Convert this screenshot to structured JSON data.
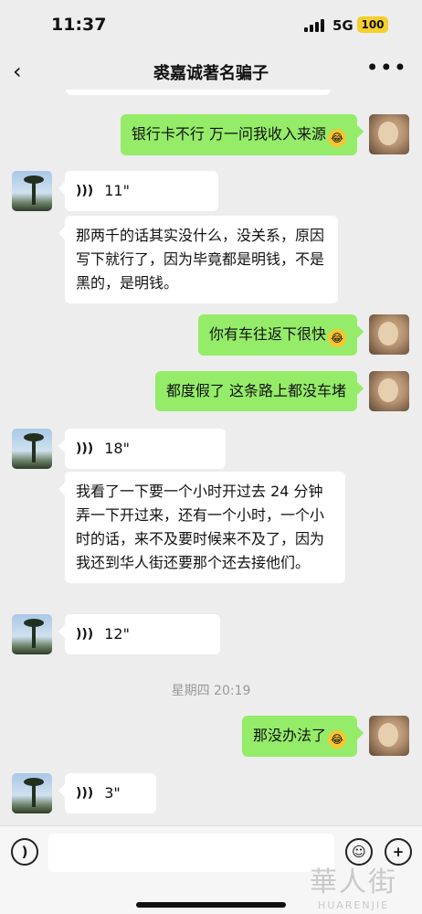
{
  "status_bar": {
    "time": "11:37",
    "network": "5G",
    "battery": "100"
  },
  "nav": {
    "back_icon": "chevron-left-icon",
    "title": "裘嘉诚著名骗子",
    "more_icon": "more-dots-icon"
  },
  "messages": [
    {
      "sender": "self",
      "type": "text",
      "text": "银行卡不行 万一问我收入来源"
    },
    {
      "sender": "other",
      "type": "voice",
      "duration": "11\""
    },
    {
      "sender": "other",
      "type": "text",
      "text": "那两千的话其实没什么，没关系，原因写下就行了，因为毕竟都是明钱，不是黑的，是明钱。"
    },
    {
      "sender": "self",
      "type": "text",
      "text": "你有车往返下很快"
    },
    {
      "sender": "self",
      "type": "text",
      "text": "都度假了 这条路上都没车堵"
    },
    {
      "sender": "other",
      "type": "voice",
      "duration": "18\""
    },
    {
      "sender": "other",
      "type": "text",
      "text": "我看了一下要一个小时开过去 24 分钟弄一下开过来，还有一个小时，一个小时的话，来不及要时候来不及了，因为我还到华人街还要那个还去接他们。"
    },
    {
      "sender": "other",
      "type": "voice",
      "duration": "12\""
    },
    {
      "sender": "self",
      "type": "text",
      "text": "那没办法了"
    },
    {
      "sender": "other",
      "type": "voice",
      "duration": "3\""
    }
  ],
  "timestamp": "星期四 20:19",
  "emoji_icon": "laughing-tears-emoji",
  "input_bar": {
    "voice_icon": "voice-input-icon",
    "emoji_button_icon": "smiley-icon",
    "add_button_icon": "plus-icon"
  },
  "watermark": {
    "line1": "華人街",
    "line2": "HUARENJIE"
  }
}
